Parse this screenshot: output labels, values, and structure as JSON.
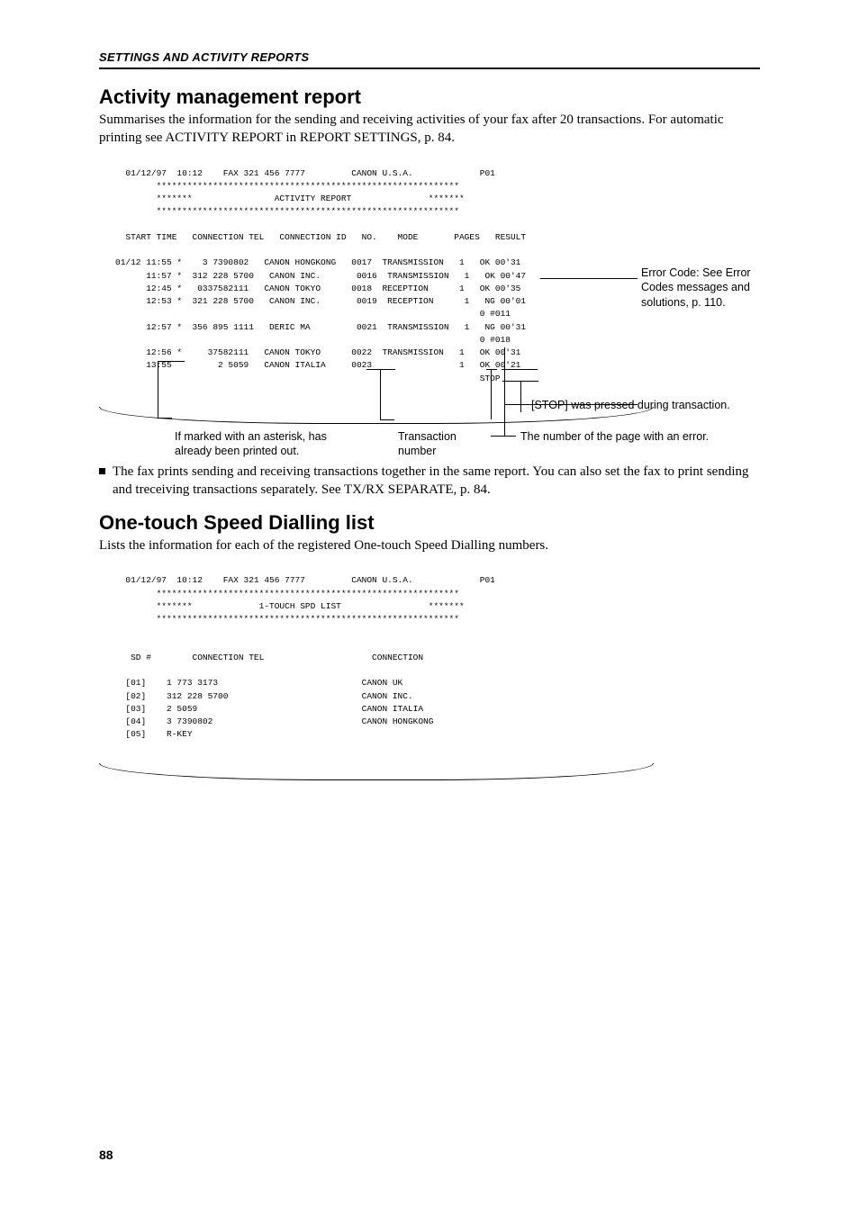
{
  "running_head": "SETTINGS AND ACTIVITY REPORTS",
  "page_number": "88",
  "section1": {
    "title": "Activity management report",
    "para": "Summarises the information for the sending and receiving activities of your fax after 20 transactions. For automatic printing see ACTIVITY REPORT in REPORT SETTINGS, p. 84.",
    "bullet": "The fax prints sending and receiving transactions together in the same report. You can also set the fax to print sending and treceiving transactions separately. See TX/RX SEPARATE, p. 84."
  },
  "report1": {
    "header": "  01/12/97  10:12    FAX 321 456 7777         CANON U.S.A.             P01",
    "stars_top": "        ***********************************************************",
    "title_line": "        *******                ACTIVITY REPORT               *******",
    "stars_bot": "        ***********************************************************",
    "cols": "  START TIME   CONNECTION TEL   CONNECTION ID   NO.    MODE       PAGES   RESULT",
    "rows": [
      "01/12 11:55 *    3 7390802   CANON HONGKONG   0017  TRANSMISSION   1   OK 00'31",
      "      11:57 *  312 228 5700   CANON INC.       0016  TRANSMISSION   1   OK 00'47",
      "      12:45 *   0337582111   CANON TOKYO      0018  RECEPTION      1   OK 00'35",
      "      12:53 *  321 228 5700   CANON INC.       0019  RECEPTION      1   NG 00'01",
      "                                                                       0 #011",
      "      12:57 *  356 895 1111   DERIC MA         0021  TRANSMISSION   1   NG 00'31",
      "                                                                       0 #018",
      "",
      "      12:56 *     37582111   CANON TOKYO      0022  TRANSMISSION   1   OK 00'31",
      "      13:55         2 5059   CANON ITALIA     0023                 1   OK 00'21",
      "                                                                       STOP"
    ],
    "callouts": {
      "error_code": "Error Code: See Error Codes messages and solutions, p. 110.",
      "stop": "[STOP] was pressed during transaction.",
      "page_err": "The number of the page with an error.",
      "asterisk": "If marked with an asterisk, has already been printed out.",
      "transaction": "Transaction number"
    }
  },
  "section2": {
    "title": "One-touch Speed Dialling list",
    "para": "Lists the information for each of the registered One-touch Speed Dialling numbers."
  },
  "report2": {
    "header": "  01/12/97  10:12    FAX 321 456 7777         CANON U.S.A.             P01",
    "stars_top": "        ***********************************************************",
    "title_line": "        *******             1-TOUCH SPD LIST                 *******",
    "stars_bot": "        ***********************************************************",
    "blank": "",
    "cols": "   SD #        CONNECTION TEL                     CONNECTION",
    "rows": [
      "  [01]    1 773 3173                            CANON UK",
      "  [02]    312 228 5700                          CANON INC.",
      "  [03]    2 5059                                CANON ITALIA",
      "  [04]    3 7390802                             CANON HONGKONG",
      "  [05]    R-KEY"
    ]
  }
}
